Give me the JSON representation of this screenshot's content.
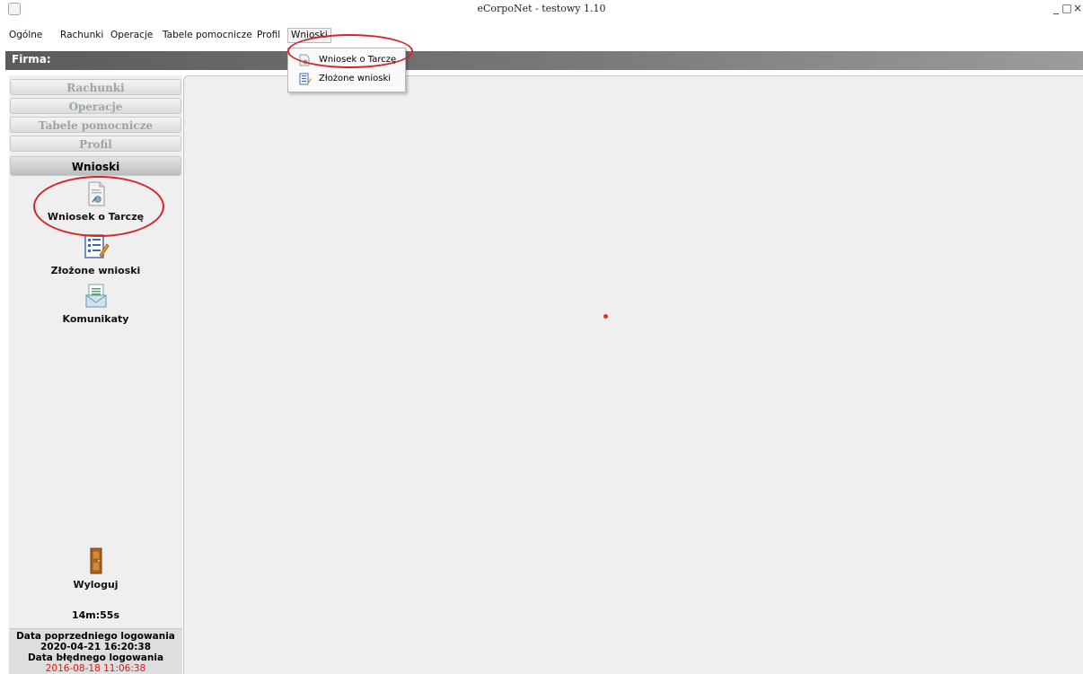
{
  "window": {
    "title": "eCorpoNet - testowy 1.10",
    "controls": [
      "_",
      "□",
      "×"
    ]
  },
  "menubar": [
    "Ogólne",
    "Rachunki",
    "Operacje",
    "Tabele pomocnicze",
    "Profil",
    "Wnioski"
  ],
  "firma": {
    "label": "Firma:"
  },
  "sidebar": {
    "nav": [
      "Rachunki",
      "Operacje",
      "Tabele pomocnicze",
      "Profil",
      "Wnioski"
    ],
    "active": "Wnioski",
    "tiles": [
      {
        "label": "Wniosek o Tarczę",
        "icon": "document-icon"
      },
      {
        "label": "Złożone wnioski",
        "icon": "list-edit-icon"
      },
      {
        "label": "Komunikaty",
        "icon": "message-icon"
      }
    ],
    "logout": {
      "label": "Wyloguj",
      "timer": "14m:55s",
      "icon": "door-icon"
    },
    "login_info": {
      "prev_label": "Data poprzedniego logowania",
      "prev_value": "2020-04-21 16:20:38",
      "failed_label": "Data błędnego logowania",
      "failed_value": "2016-08-18 11:06:38"
    }
  },
  "dropdown": {
    "items": [
      {
        "label": "Wniosek o Tarczę",
        "icon": "document-icon"
      },
      {
        "label": "Złożone wnioski",
        "icon": "list-edit-icon"
      }
    ]
  },
  "colors": {
    "annotation": "#d8232a",
    "failed_login": "#d81a1a"
  }
}
